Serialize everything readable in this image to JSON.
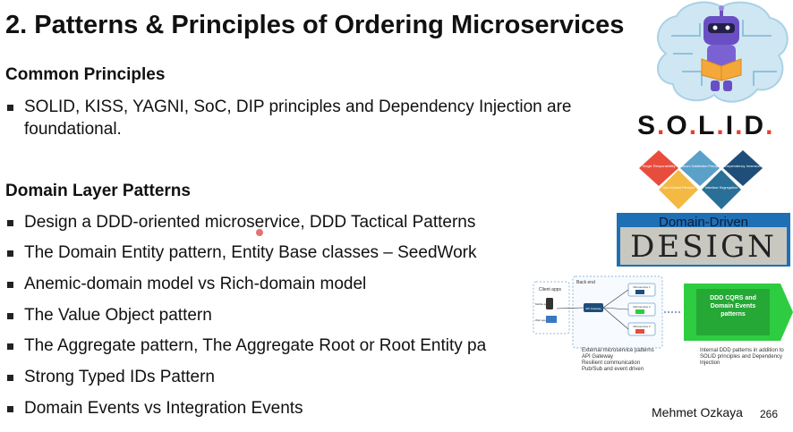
{
  "slide": {
    "title": "2. Patterns & Principles of Ordering Microservices",
    "section1_heading": "Common Principles",
    "section1_bullets": [
      "SOLID, KISS, YAGNI, SoC, DIP principles and Dependency Injection are foundational."
    ],
    "section2_heading": "Domain Layer Patterns",
    "section2_bullets": [
      "Design a DDD-oriented microservice, DDD Tactical Patterns",
      "The Domain Entity pattern, Entity Base classes – SeedWork",
      "Anemic-domain model vs Rich-domain model",
      "The Value Object pattern",
      "The Aggregate pattern, The Aggregate Root or Root Entity pa",
      "Strong Typed IDs Pattern",
      "Domain Events vs Integration Events"
    ],
    "author": "Mehmet Ozkaya",
    "page_number": "266"
  },
  "images": {
    "solid_logo": {
      "letters": [
        "S",
        "O",
        "L",
        "I",
        "D"
      ],
      "diamonds": [
        "Single Responsibility",
        "Liskov's Substitution Principle",
        "Dependency Inversion",
        "Open/Closed Principle",
        "Interface Segregation"
      ]
    },
    "ddd_book": {
      "top": "Domain-Driven",
      "big": "DESIGN"
    },
    "architecture": {
      "client_label": "Client apps",
      "client_items": [
        "Mobile app",
        "Web app"
      ],
      "backend_label": "Back end",
      "gateway_label": "API Gateway",
      "microservices": [
        "Microservice 1",
        "Microservice 2",
        "Microservice 3"
      ],
      "arrow_text": "DDD CQRS and Domain Events patterns",
      "left_notes": [
        "External microservice patterns",
        "API Gateway",
        "Resilient communication",
        "Pub/Sub and event driven"
      ],
      "right_note": "Internal DDD patterns in addition to SOLID principles and Dependency Injection"
    }
  },
  "colors": {
    "solid_dots": "#e8412c",
    "diamond_colors": [
      "#e84c3d",
      "#5aa0c8",
      "#1e4e79",
      "#f4b942",
      "#2a6f97"
    ],
    "ddd_blue": "#1f6fb5",
    "arrow_green": "#2ecc40"
  }
}
